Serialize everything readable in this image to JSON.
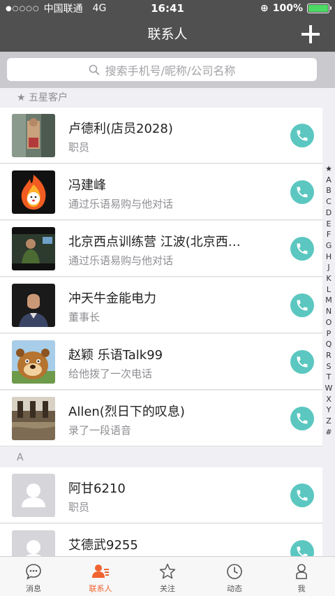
{
  "status": {
    "carrier": "中国联通",
    "network": "4G",
    "time": "16:41",
    "battery": "100%",
    "battery_level": 1.0
  },
  "navbar": {
    "title": "联系人",
    "add_icon": "plus-icon"
  },
  "search": {
    "placeholder": "搜索手机号/昵称/公司名称",
    "icon": "search-icon"
  },
  "sections": [
    {
      "label": "★ 五星客户"
    },
    {
      "label": "A"
    }
  ],
  "contacts": [
    {
      "name": "卢德利(店员2028)",
      "sub": "职员"
    },
    {
      "name": "冯建峰",
      "sub": "通过乐语易购与他对话"
    },
    {
      "name": "北京西点训练营 江波(北京西…",
      "sub": "通过乐语易购与他对话"
    },
    {
      "name": "冲天牛金能电力",
      "sub": "董事长"
    },
    {
      "name": "赵颖 乐语Talk99",
      "sub": "给他拨了一次电话"
    },
    {
      "name": "Allen(烈日下的叹息)",
      "sub": "录了一段语音"
    },
    {
      "name": "阿甘6210",
      "sub": "职员"
    },
    {
      "name": "艾德武9255",
      "sub": ""
    }
  ],
  "index_letters": [
    "★",
    "A",
    "B",
    "C",
    "D",
    "E",
    "F",
    "G",
    "H",
    "J",
    "K",
    "L",
    "M",
    "N",
    "O",
    "P",
    "Q",
    "R",
    "S",
    "T",
    "W",
    "X",
    "Y",
    "Z",
    "#"
  ],
  "tabs": [
    {
      "label": "消息",
      "icon": "message-icon"
    },
    {
      "label": "联系人",
      "icon": "contacts-icon"
    },
    {
      "label": "关注",
      "icon": "star-icon"
    },
    {
      "label": "动态",
      "icon": "clock-icon"
    },
    {
      "label": "我",
      "icon": "person-icon"
    }
  ],
  "colors": {
    "accent": "#f0632f",
    "call": "#5bc7c0",
    "header": "#505050"
  }
}
